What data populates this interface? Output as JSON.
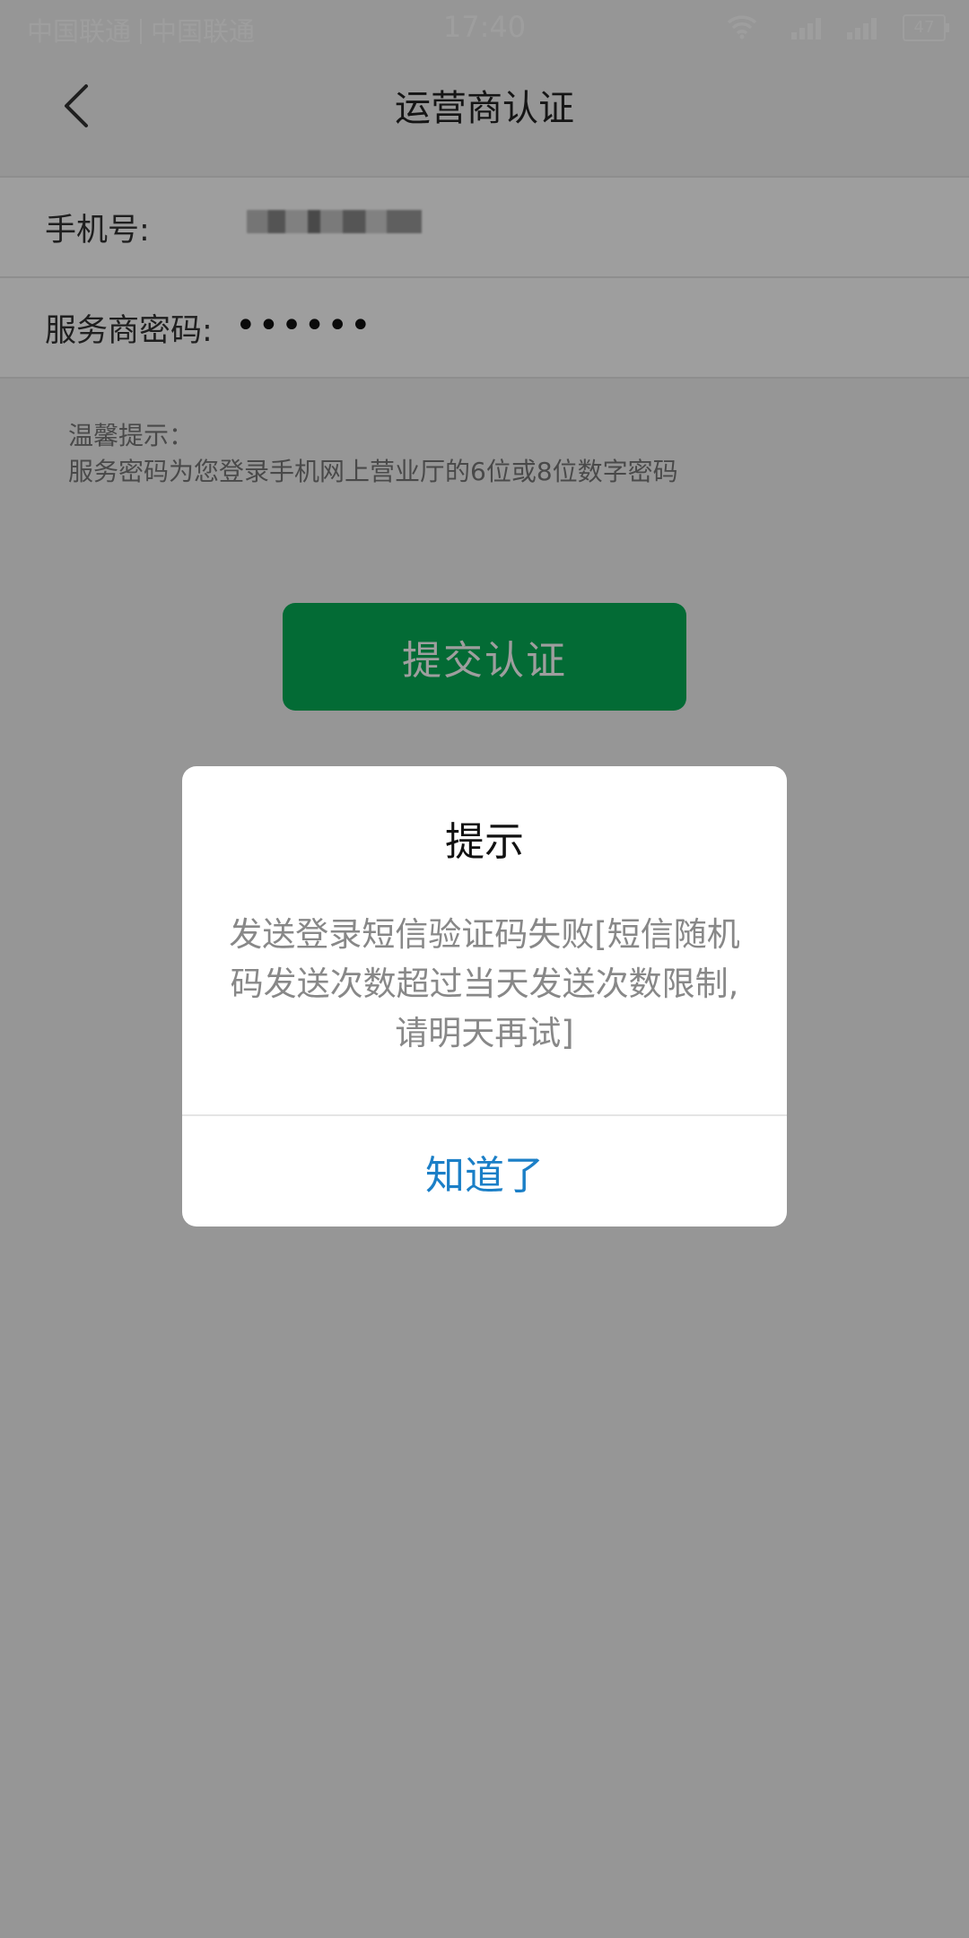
{
  "status_bar": {
    "carrier_1": "中国联通",
    "carrier_2": "中国联通",
    "time": "17:40",
    "battery": "47"
  },
  "nav": {
    "title": "运营商认证"
  },
  "form": {
    "phone_label": "手机号:",
    "password_label": "服务商密码:",
    "password_value": "••••••"
  },
  "tip": {
    "heading": "温馨提示：",
    "text": "服务密码为您登录手机网上营业厅的6位或8位数字密码"
  },
  "submit_button": "提交认证",
  "dialog": {
    "title": "提示",
    "message": "发送登录短信验证码失败[短信随机码发送次数超过当天发送次数限制,请明天再试]",
    "ok_button": "知道了"
  },
  "colors": {
    "primary_green": "#06ad56",
    "dialog_button_blue": "#1b7fc7"
  }
}
